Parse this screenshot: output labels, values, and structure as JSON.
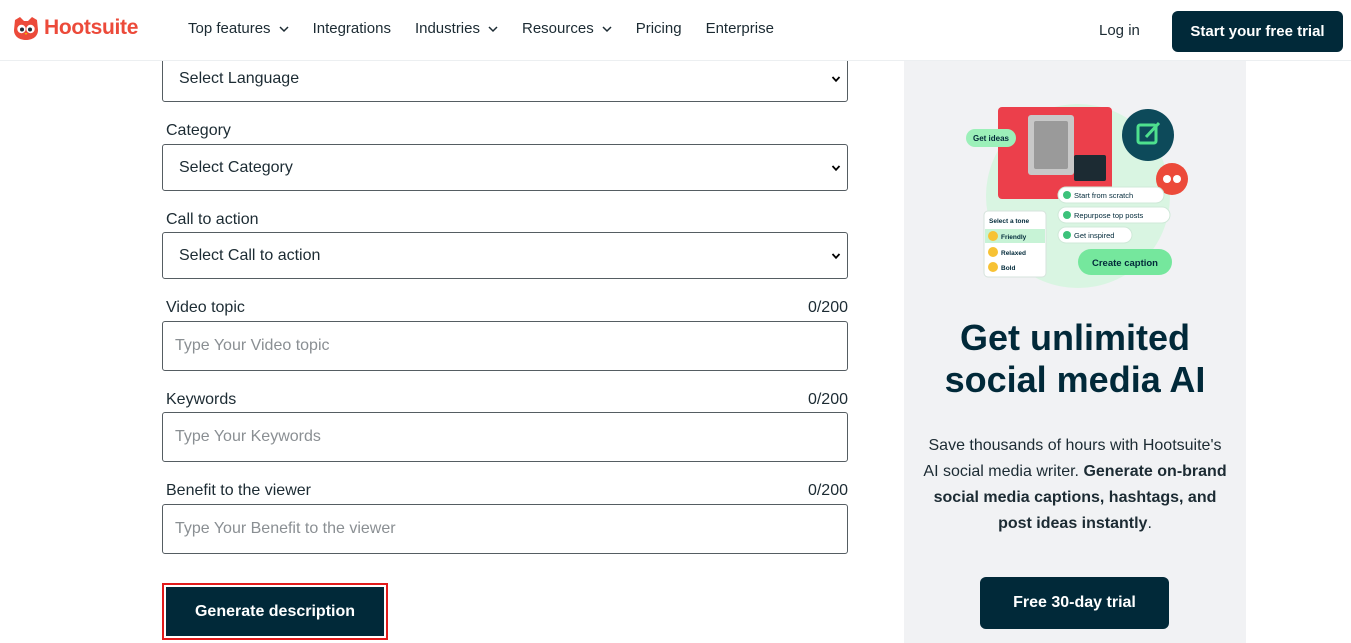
{
  "header": {
    "logo_text": "Hootsuite",
    "nav": [
      {
        "label": "Top features",
        "has_dropdown": true
      },
      {
        "label": "Integrations",
        "has_dropdown": false
      },
      {
        "label": "Industries",
        "has_dropdown": true
      },
      {
        "label": "Resources",
        "has_dropdown": true
      },
      {
        "label": "Pricing",
        "has_dropdown": false
      },
      {
        "label": "Enterprise",
        "has_dropdown": false
      }
    ],
    "login_label": "Log in",
    "trial_label": "Start your free trial"
  },
  "form": {
    "language": {
      "value": "Select Language"
    },
    "category": {
      "label": "Category",
      "value": "Select Category"
    },
    "cta": {
      "label": "Call to action",
      "value": "Select Call to action"
    },
    "video_topic": {
      "label": "Video topic",
      "counter": "0/200",
      "placeholder": "Type Your Video topic"
    },
    "keywords": {
      "label": "Keywords",
      "counter": "0/200",
      "placeholder": "Type Your Keywords"
    },
    "benefit": {
      "label": "Benefit to the viewer",
      "counter": "0/200",
      "placeholder": "Type Your Benefit to the viewer"
    },
    "generate_label": "Generate description"
  },
  "promo": {
    "illustration": {
      "get_ideas": "Get ideas",
      "options": [
        "Start from scratch",
        "Repurpose top posts",
        "Get inspired"
      ],
      "tone_title": "Select a tone",
      "tones": [
        "Friendly",
        "Relaxed",
        "Bold"
      ],
      "create_caption": "Create caption"
    },
    "title": "Get unlimited social media AI",
    "desc_plain": "Save thousands of hours with Hootsuite's AI social media writer.",
    "desc_bold": "Generate on-brand social media captions, hashtags, and post ideas instantly",
    "desc_end": ".",
    "button_label": "Free 30-day trial"
  },
  "colors": {
    "brand_red": "#ec4a3a",
    "dark_navy": "#012939",
    "highlight_outline": "#e21b1b",
    "promo_bg": "#f1f2f4"
  }
}
